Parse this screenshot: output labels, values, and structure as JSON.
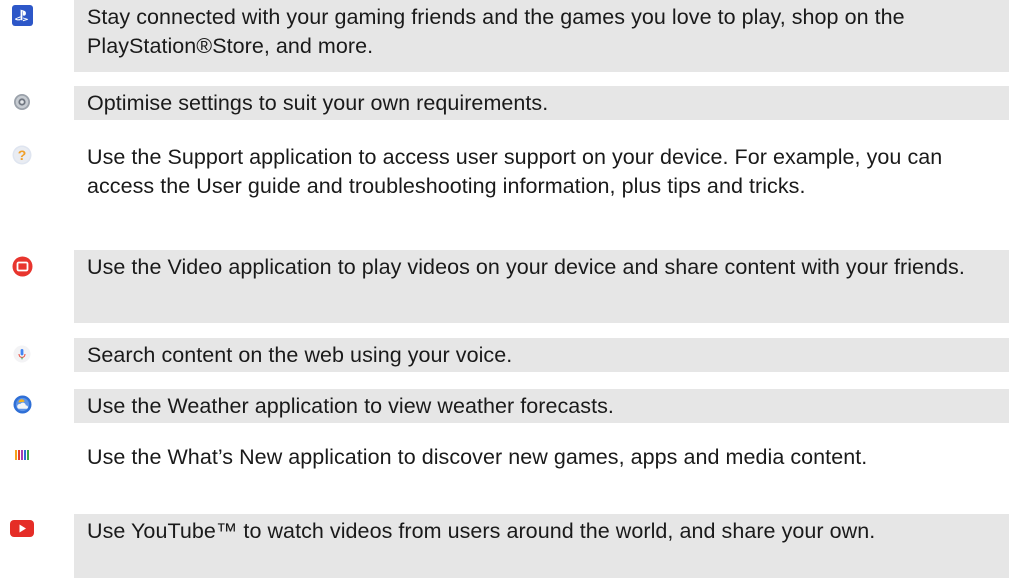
{
  "apps": [
    {
      "icon": "playstation-icon",
      "description": "Stay connected with your gaming friends and the games you love to play, shop on the PlayStation®Store, and more."
    },
    {
      "icon": "settings-gear-icon",
      "description": "Optimise settings to suit your own requirements."
    },
    {
      "icon": "support-question-icon",
      "description": "Use the Support application to access user support on your device. For example, you can access the User guide and troubleshooting information, plus tips and tricks."
    },
    {
      "icon": "video-icon",
      "description": "Use the Video application to play videos on your device and share content with your friends."
    },
    {
      "icon": "voice-search-microphone-icon",
      "description": "Search content on the web using your voice."
    },
    {
      "icon": "weather-icon",
      "description": "Use the Weather application to view weather forecasts."
    },
    {
      "icon": "whats-new-icon",
      "description": "Use the What’s New application to discover new games, apps and media content."
    },
    {
      "icon": "youtube-icon",
      "description": "Use YouTube™ to watch videos from users around the world, and share your own."
    }
  ],
  "colors": {
    "row_background": "#e6e6e6",
    "text": "#1a1a1a",
    "playstation_blue": "#2d57c8",
    "video_red": "#e8352e",
    "youtube_red": "#e52d27",
    "settings_gray": "#8a9099"
  }
}
